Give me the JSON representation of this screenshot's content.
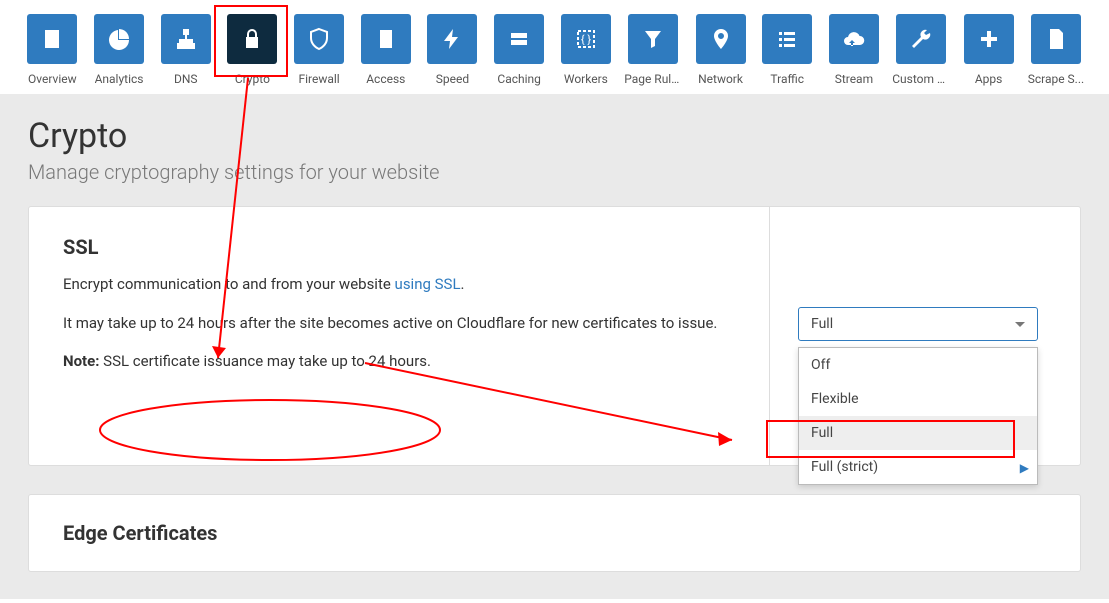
{
  "nav": [
    {
      "label": "Overview",
      "icon": "document"
    },
    {
      "label": "Analytics",
      "icon": "pie"
    },
    {
      "label": "DNS",
      "icon": "sitemap"
    },
    {
      "label": "Crypto",
      "icon": "lock",
      "active": true
    },
    {
      "label": "Firewall",
      "icon": "shield"
    },
    {
      "label": "Access",
      "icon": "door"
    },
    {
      "label": "Speed",
      "icon": "bolt"
    },
    {
      "label": "Caching",
      "icon": "drive"
    },
    {
      "label": "Workers",
      "icon": "braces"
    },
    {
      "label": "Page Rules",
      "icon": "funnel"
    },
    {
      "label": "Network",
      "icon": "pin"
    },
    {
      "label": "Traffic",
      "icon": "list"
    },
    {
      "label": "Stream",
      "icon": "cloud"
    },
    {
      "label": "Custom P...",
      "icon": "wrench"
    },
    {
      "label": "Apps",
      "icon": "plus"
    },
    {
      "label": "Scrape S...",
      "icon": "page"
    }
  ],
  "page": {
    "title": "Crypto",
    "subtitle": "Manage cryptography settings for your website"
  },
  "ssl": {
    "title": "SSL",
    "desc_prefix": "Encrypt communication to and from your website ",
    "desc_link": "using SSL",
    "desc_suffix": ".",
    "delay": "It may take up to 24 hours after the site becomes active on Cloudflare for new certificates to issue.",
    "note_label": "Note:",
    "note_text": " SSL certificate issuance may take up to 24 hours.",
    "select_value": "Full",
    "options": [
      "Off",
      "Flexible",
      "Full",
      "Full (strict)"
    ],
    "selected_index": 2
  },
  "edge": {
    "title": "Edge Certificates"
  }
}
